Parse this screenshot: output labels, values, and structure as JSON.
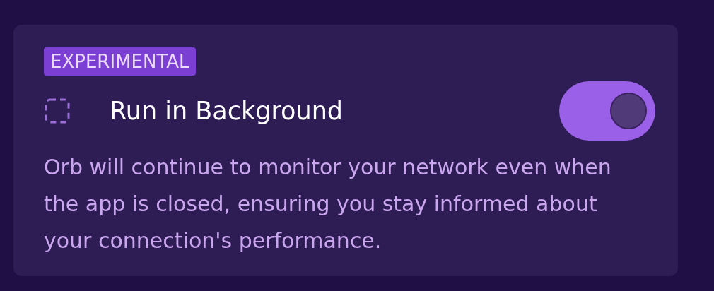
{
  "setting": {
    "badge": "EXPERIMENTAL",
    "title": "Run in Background",
    "on": true,
    "description": "Orb will continue to monitor your network even when the app is closed, ensuring you stay informed about your connection's performance."
  }
}
